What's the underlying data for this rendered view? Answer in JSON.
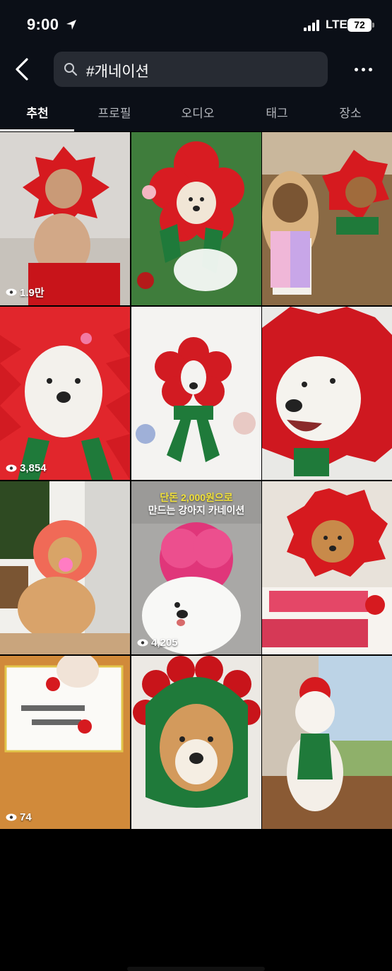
{
  "status_bar": {
    "time": "9:00",
    "network": "LTE",
    "battery": "72"
  },
  "search": {
    "query": "#개네이션"
  },
  "tabs": [
    {
      "label": "추천",
      "active": true
    },
    {
      "label": "프로필",
      "active": false
    },
    {
      "label": "오디오",
      "active": false
    },
    {
      "label": "태그",
      "active": false
    },
    {
      "label": "장소",
      "active": false
    }
  ],
  "grid": {
    "tiles": [
      {
        "views": "1.9만"
      },
      {
        "views": ""
      },
      {
        "views": ""
      },
      {
        "views": "3,854"
      },
      {
        "views": ""
      },
      {
        "views": ""
      },
      {
        "views": ""
      },
      {
        "views": "4,205",
        "title_line1": "단돈 2,000원으로",
        "title_line2": "만드는 강아지 카네이션"
      },
      {
        "views": ""
      },
      {
        "views": "74"
      },
      {
        "views": ""
      },
      {
        "views": ""
      }
    ]
  },
  "colors": {
    "background": "#000000",
    "header": "#0b0f17",
    "search_box": "#272b33",
    "carnation_red": "#d61a1f",
    "ribbon_green": "#1f7a3a"
  },
  "icons": [
    "location-arrow-icon",
    "signal-icon",
    "battery-icon",
    "back-chevron-icon",
    "search-icon",
    "more-icon",
    "eye-icon"
  ]
}
